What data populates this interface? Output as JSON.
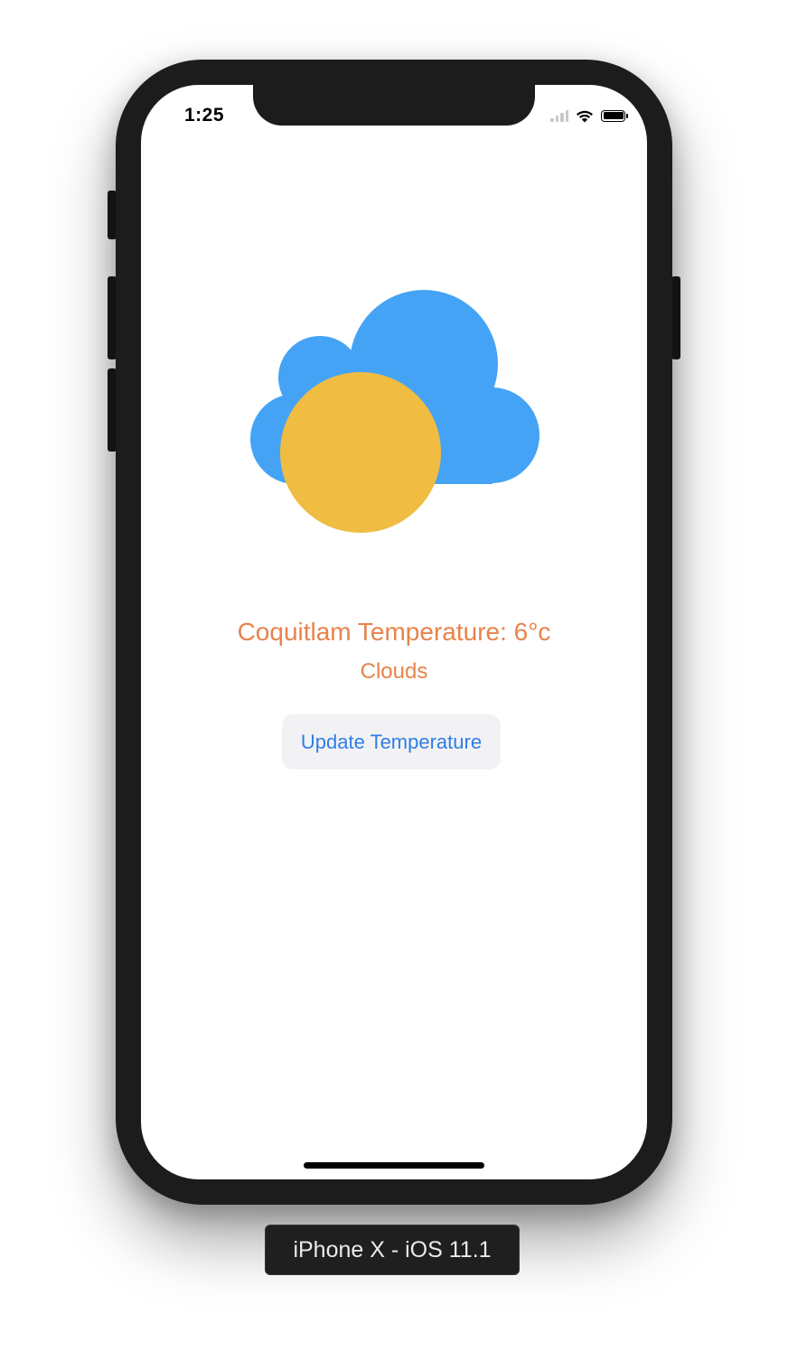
{
  "status_bar": {
    "time": "1:25"
  },
  "weather": {
    "icon": "partly-cloudy-icon",
    "cloud_color": "#45a3f5",
    "sun_color": "#f0bc41",
    "temperature_text": "Coquitlam Temperature: 6°c",
    "condition": "Clouds",
    "text_color": "#e8834a"
  },
  "actions": {
    "update_label": "Update Temperature",
    "button_text_color": "#2f7ee6"
  },
  "device": {
    "label": "iPhone X - iOS 11.1"
  }
}
